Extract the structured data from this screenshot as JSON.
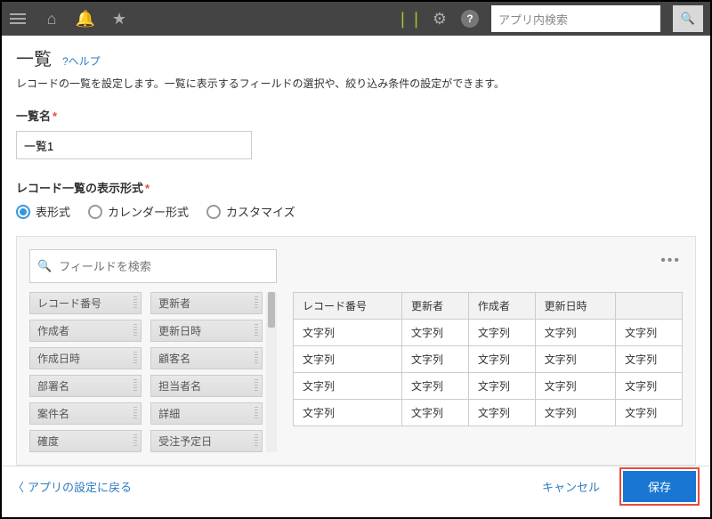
{
  "topbar": {
    "search_placeholder": "アプリ内検索"
  },
  "page": {
    "title": "一覧",
    "help_label": "?ヘルプ",
    "description": "レコードの一覧を設定します。一覧に表示するフィールドの選択や、絞り込み条件の設定ができます。"
  },
  "form": {
    "name_label": "一覧名",
    "name_value": "一覧1",
    "display_label": "レコード一覧の表示形式",
    "radios": [
      {
        "label": "表形式",
        "checked": true
      },
      {
        "label": "カレンダー形式",
        "checked": false
      },
      {
        "label": "カスタマイズ",
        "checked": false
      }
    ]
  },
  "field_search_placeholder": "フィールドを検索",
  "field_list_left": [
    "レコード番号",
    "作成者",
    "作成日時",
    "部署名",
    "案件名",
    "確度"
  ],
  "field_list_right": [
    "更新者",
    "更新日時",
    "顧客名",
    "担当者名",
    "詳細",
    "受注予定日"
  ],
  "table": {
    "headers": [
      "レコード番号",
      "更新者",
      "作成者",
      "更新日時",
      ""
    ],
    "cell": "文字列",
    "rows": 4,
    "cols": 5
  },
  "footer": {
    "back_label": "アプリの設定に戻る",
    "cancel_label": "キャンセル",
    "save_label": "保存"
  }
}
